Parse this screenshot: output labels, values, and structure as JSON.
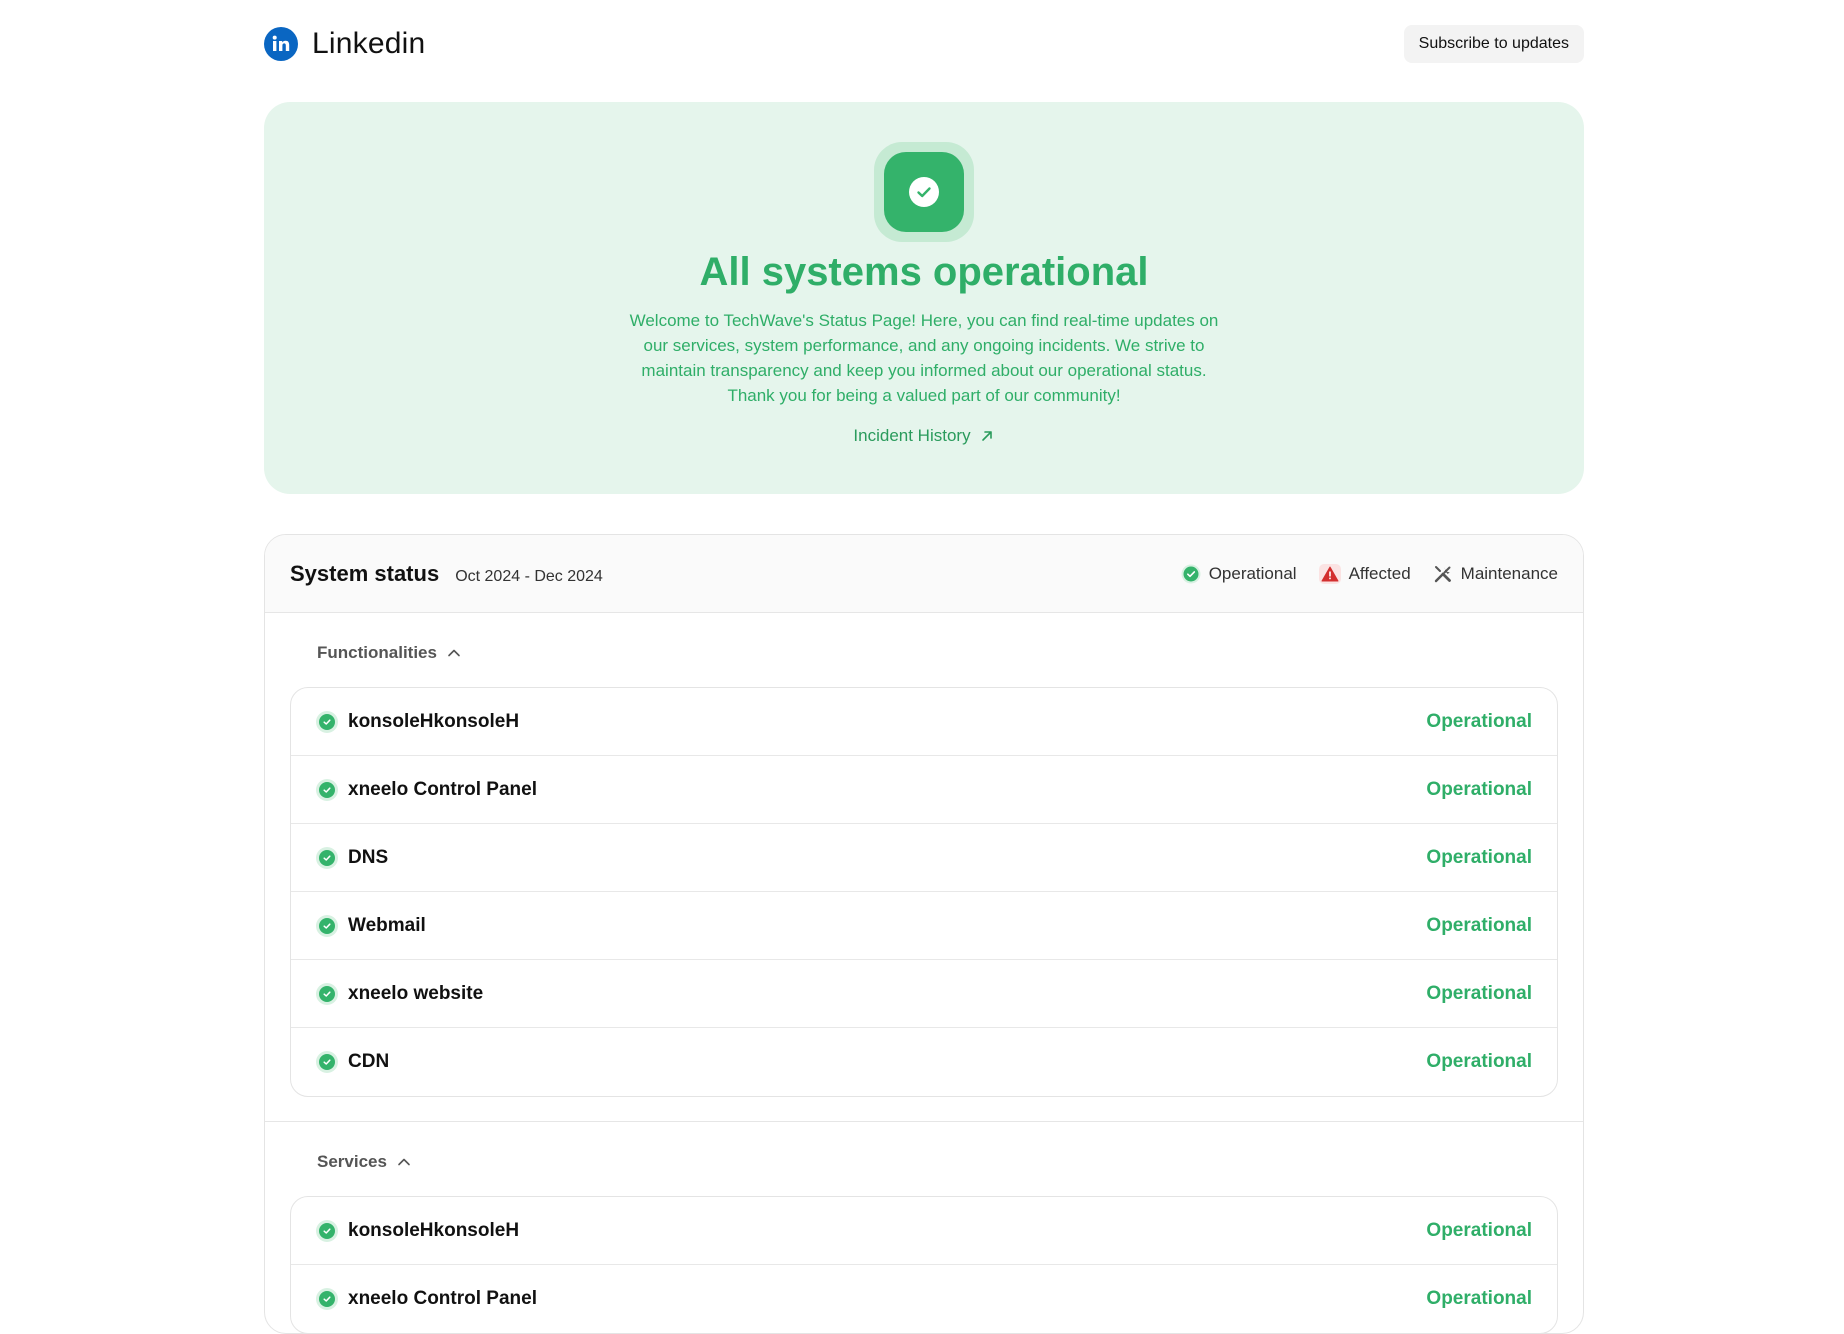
{
  "header": {
    "brand_name": "Linkedin",
    "subscribe_label": "Subscribe to updates"
  },
  "hero": {
    "title": "All systems operational",
    "description": "Welcome to TechWave's Status Page! Here, you can find real-time updates on our services, system performance, and any ongoing incidents. We strive to maintain transparency and keep you informed about our operational status. Thank you for being a valued part of our community!",
    "link_label": "Incident History"
  },
  "status": {
    "title": "System status",
    "range": "Oct 2024 - Dec 2024",
    "legend": {
      "operational": "Operational",
      "affected": "Affected",
      "maintenance": "Maintenance"
    },
    "groups": [
      {
        "label": "Functionalities",
        "items": [
          {
            "name": "konsoleHkonsoleH",
            "status": "Operational"
          },
          {
            "name": "xneelo Control Panel",
            "status": "Operational"
          },
          {
            "name": "DNS",
            "status": "Operational"
          },
          {
            "name": "Webmail",
            "status": "Operational"
          },
          {
            "name": "xneelo website",
            "status": "Operational"
          },
          {
            "name": "CDN",
            "status": "Operational"
          }
        ]
      },
      {
        "label": "Services",
        "items": [
          {
            "name": "konsoleHkonsoleH",
            "status": "Operational"
          },
          {
            "name": "xneelo Control Panel",
            "status": "Operational"
          }
        ]
      }
    ]
  },
  "colors": {
    "accent_green": "#2fae68",
    "hero_bg": "#e5f5ec",
    "brand_blue": "#0a66c2",
    "affected_red": "#d32f2f"
  }
}
